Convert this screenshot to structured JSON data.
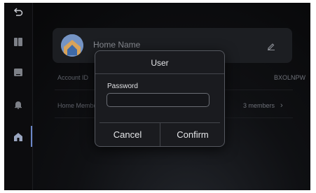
{
  "rail": {
    "items": [
      {
        "name": "back-icon"
      },
      {
        "name": "book-icon"
      },
      {
        "name": "screen-icon"
      },
      {
        "name": "bell-icon"
      },
      {
        "name": "home-icon",
        "active": true
      }
    ]
  },
  "home": {
    "name_placeholder": "Home Name",
    "account_label": "Account ID",
    "account_value": "BXOLNPW",
    "members_label": "Home Members",
    "members_value": "3 members",
    "members_chevron": "›"
  },
  "dialog": {
    "title": "User",
    "password_label": "Password",
    "password_value": "",
    "cancel_label": "Cancel",
    "confirm_label": "Confirm"
  },
  "colors": {
    "accent": "#6b87c9",
    "dialog_bg": "#1a1b1f",
    "screen_bg": "#0f1013"
  }
}
